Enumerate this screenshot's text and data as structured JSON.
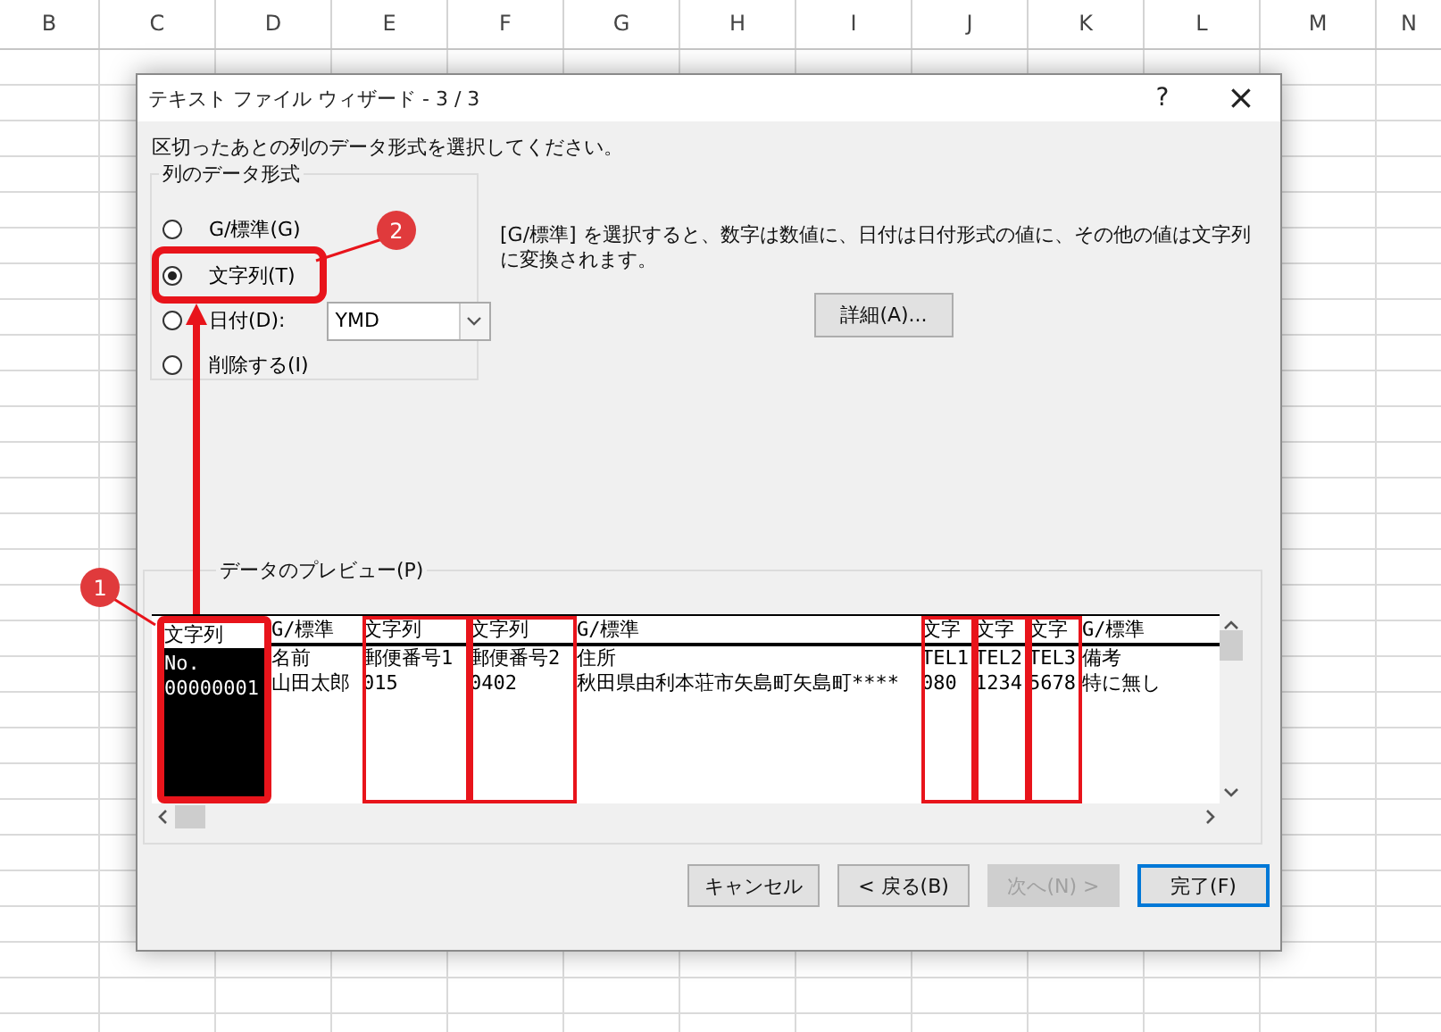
{
  "sheet": {
    "columns": [
      "B",
      "C",
      "D",
      "E",
      "F",
      "G",
      "H",
      "I",
      "J",
      "K",
      "L",
      "M",
      "N"
    ]
  },
  "window": {
    "title": "テキスト ファイル ウィザード - 3 / 3",
    "help": "?",
    "close": "×"
  },
  "instruction": "区切ったあとの列のデータ形式を選択してください。",
  "format_group": {
    "title": "列のデータ形式",
    "options": [
      {
        "label": "G/標準(G)",
        "selected": false,
        "highlighted": false,
        "kind": "plain"
      },
      {
        "label": "文字列(T)",
        "selected": true,
        "highlighted": true,
        "kind": "plain"
      },
      {
        "label": "日付(D):",
        "selected": false,
        "highlighted": false,
        "kind": "date",
        "dropdown": "YMD"
      },
      {
        "label": "削除する(I)",
        "selected": false,
        "highlighted": false,
        "kind": "plain"
      }
    ]
  },
  "description": "[G/標準] を選択すると、数字は数値に、日付は日付形式の値に、その他の値は文字列に変換されます。",
  "advanced_button": "詳細(A)...",
  "preview": {
    "title": "データのプレビュー(P)",
    "columns": [
      {
        "type": "文字列",
        "cells": [
          "No.",
          "00000001"
        ],
        "selected": true,
        "highlighted": true
      },
      {
        "type": "G/標準",
        "cells": [
          "名前",
          "山田太郎"
        ],
        "selected": false,
        "highlighted": false
      },
      {
        "type": "文字列",
        "cells": [
          "郵便番号1",
          "015"
        ],
        "selected": false,
        "highlighted": true
      },
      {
        "type": "文字列",
        "cells": [
          "郵便番号2",
          "0402"
        ],
        "selected": false,
        "highlighted": true
      },
      {
        "type": "G/標準",
        "cells": [
          "住所",
          "秋田県由利本荘市矢島町矢島町****"
        ],
        "selected": false,
        "highlighted": false
      },
      {
        "type": "文字",
        "cells": [
          "TEL1",
          "080"
        ],
        "selected": false,
        "highlighted": true
      },
      {
        "type": "文字",
        "cells": [
          "TEL2",
          "1234"
        ],
        "selected": false,
        "highlighted": true
      },
      {
        "type": "文字",
        "cells": [
          "TEL3",
          "5678"
        ],
        "selected": false,
        "highlighted": true
      },
      {
        "type": "G/標準",
        "cells": [
          "備考",
          "特に無し"
        ],
        "selected": false,
        "highlighted": false
      }
    ]
  },
  "buttons": [
    {
      "label": "キャンセル",
      "disabled": false,
      "default": false
    },
    {
      "label": "< 戻る(B)",
      "disabled": false,
      "default": false
    },
    {
      "label": "次へ(N) >",
      "disabled": true,
      "default": false
    },
    {
      "label": "完了(F)",
      "disabled": false,
      "default": true
    }
  ],
  "markers": [
    {
      "label": "1"
    },
    {
      "label": "2"
    }
  ]
}
